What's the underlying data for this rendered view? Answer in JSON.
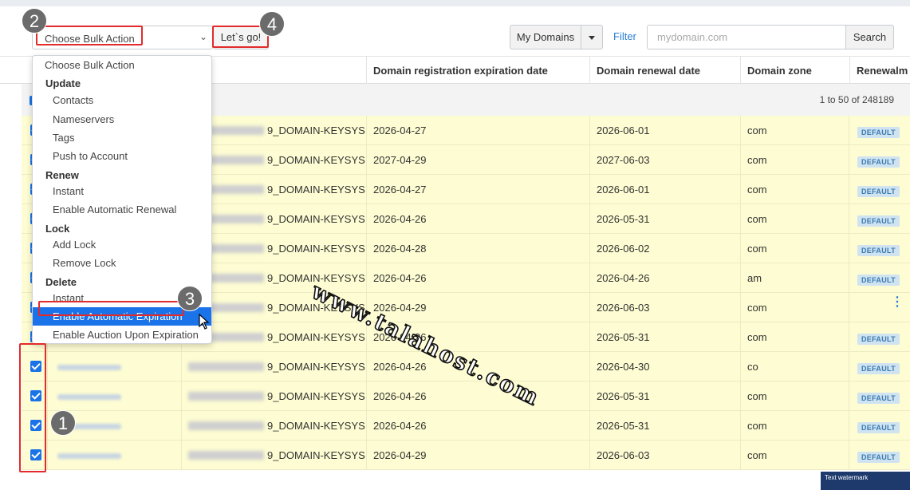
{
  "toolbar": {
    "bulk_select_value": "Choose Bulk Action",
    "go_button": "Let`s go!",
    "my_domains": "My Domains",
    "filter_link": "Filter",
    "search_placeholder": "mydomain.com",
    "search_button": "Search"
  },
  "table": {
    "headers": [
      "Domain registration expiration date",
      "Domain renewal date",
      "Domain zone",
      "Renewalm"
    ],
    "count_label": "1 to 50 of 248189",
    "domain_suffix": "9_DOMAIN-KEYSYS",
    "badge_label": "DEFAULT",
    "rows": [
      {
        "exp": "2026-04-27",
        "renew": "2026-06-01",
        "zone": "com",
        "badge": "DEFAULT"
      },
      {
        "exp": "2027-04-29",
        "renew": "2027-06-03",
        "zone": "com",
        "badge": "DEFAULT"
      },
      {
        "exp": "2026-04-27",
        "renew": "2026-06-01",
        "zone": "com",
        "badge": "DEFAULT"
      },
      {
        "exp": "2026-04-26",
        "renew": "2026-05-31",
        "zone": "com",
        "badge": "DEFAULT"
      },
      {
        "exp": "2026-04-28",
        "renew": "2026-06-02",
        "zone": "com",
        "badge": "DEFAULT"
      },
      {
        "exp": "2026-04-26",
        "renew": "2026-04-26",
        "zone": "am",
        "badge": "DEFAULT"
      },
      {
        "exp": "2026-04-29",
        "renew": "2026-06-03",
        "zone": "com",
        "badge": ""
      },
      {
        "exp": "2026-04-26",
        "renew": "2026-05-31",
        "zone": "com",
        "badge": "DEFAULT"
      },
      {
        "exp": "2026-04-26",
        "renew": "2026-04-30",
        "zone": "co",
        "badge": "DEFAULT"
      },
      {
        "exp": "2026-04-26",
        "renew": "2026-05-31",
        "zone": "com",
        "badge": "DEFAULT"
      },
      {
        "exp": "2026-04-26",
        "renew": "2026-05-31",
        "zone": "com",
        "badge": "DEFAULT"
      },
      {
        "exp": "2026-04-29",
        "renew": "2026-06-03",
        "zone": "com",
        "badge": "DEFAULT"
      }
    ]
  },
  "dropdown": {
    "items": [
      {
        "label": "Choose Bulk Action",
        "kind": "first"
      },
      {
        "label": "Update",
        "kind": "group"
      },
      {
        "label": "Contacts",
        "kind": "sub"
      },
      {
        "label": "Nameservers",
        "kind": "sub"
      },
      {
        "label": "Tags",
        "kind": "sub"
      },
      {
        "label": "Push to Account",
        "kind": "sub"
      },
      {
        "label": "Renew",
        "kind": "group"
      },
      {
        "label": "Instant",
        "kind": "sub"
      },
      {
        "label": "Enable Automatic Renewal",
        "kind": "sub"
      },
      {
        "label": "Lock",
        "kind": "group"
      },
      {
        "label": "Add Lock",
        "kind": "sub"
      },
      {
        "label": "Remove Lock",
        "kind": "sub"
      },
      {
        "label": "Delete",
        "kind": "group"
      },
      {
        "label": "Instant",
        "kind": "sub"
      },
      {
        "label": "Enable Automatic Expiration",
        "kind": "sub",
        "selected": true
      },
      {
        "label": "Enable Auction Upon Expiration",
        "kind": "sub"
      }
    ]
  },
  "annotations": {
    "steps": [
      "1",
      "2",
      "3",
      "4"
    ],
    "watermark": "www.talahost.com",
    "text_watermark": "Text watermark"
  },
  "colors": {
    "row_highlight": "#fdfcd2",
    "selected": "#1a73e8",
    "annotation_red": "#e32b2b",
    "link": "#2a7fd4"
  }
}
